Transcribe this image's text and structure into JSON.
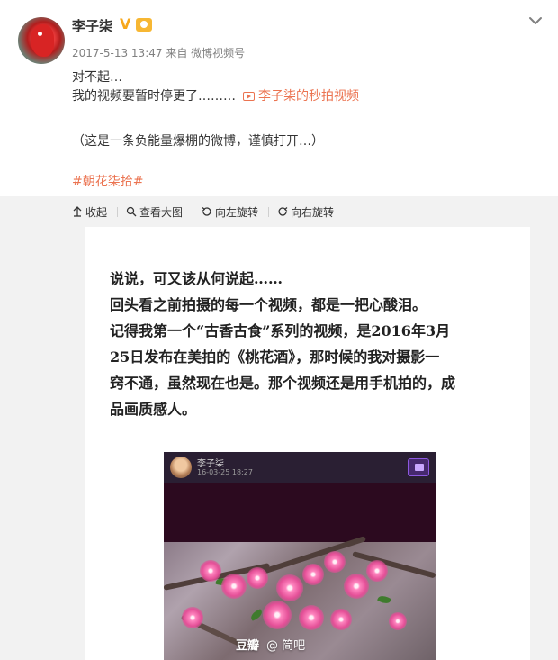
{
  "post": {
    "username": "李子柒",
    "verified_badge": "V",
    "meta": "2017-5-13 13:47 来自 微博视频号",
    "line1": "对不起…",
    "line2_text": "我的视频要暂时停更了………",
    "line2_link": "李子柒的秒拍视频",
    "line3": "（这是一条负能量爆棚的微博，谨慎打开…）",
    "hashtag": "#朝花柒拾#"
  },
  "toolbar": {
    "collapse": "收起",
    "view_large": "查看大图",
    "rotate_left": "向左旋转",
    "rotate_right": "向右旋转"
  },
  "article": {
    "lines": [
      "说说，可又该从何说起……",
      "回头看之前拍摄的每一个视频，都是一把心酸泪。",
      "记得我第一个“古香古食”系列的视频，是2016年3月",
      "25日发布在美拍的《桃花酒》，那时候的我对摄影一",
      "窍不通，虽然现在也是。那个视频还是用手机拍的，成",
      "品画质感人。"
    ]
  },
  "embedded": {
    "name": "李子柒",
    "date": "16-03-25 18:27",
    "watermark_left": "豆瓣",
    "watermark_right": "@ 简吧"
  },
  "colors": {
    "link": "#eb7350",
    "badge": "#f7a71b",
    "panel": "#f2f2f2"
  },
  "icons": {
    "more": "chevron-down-icon",
    "collapse": "arrow-up-icon",
    "view_large": "magnifier-icon",
    "rotate_left": "rotate-left-icon",
    "rotate_right": "rotate-right-icon",
    "video": "video-icon",
    "gift": "gift-icon"
  }
}
